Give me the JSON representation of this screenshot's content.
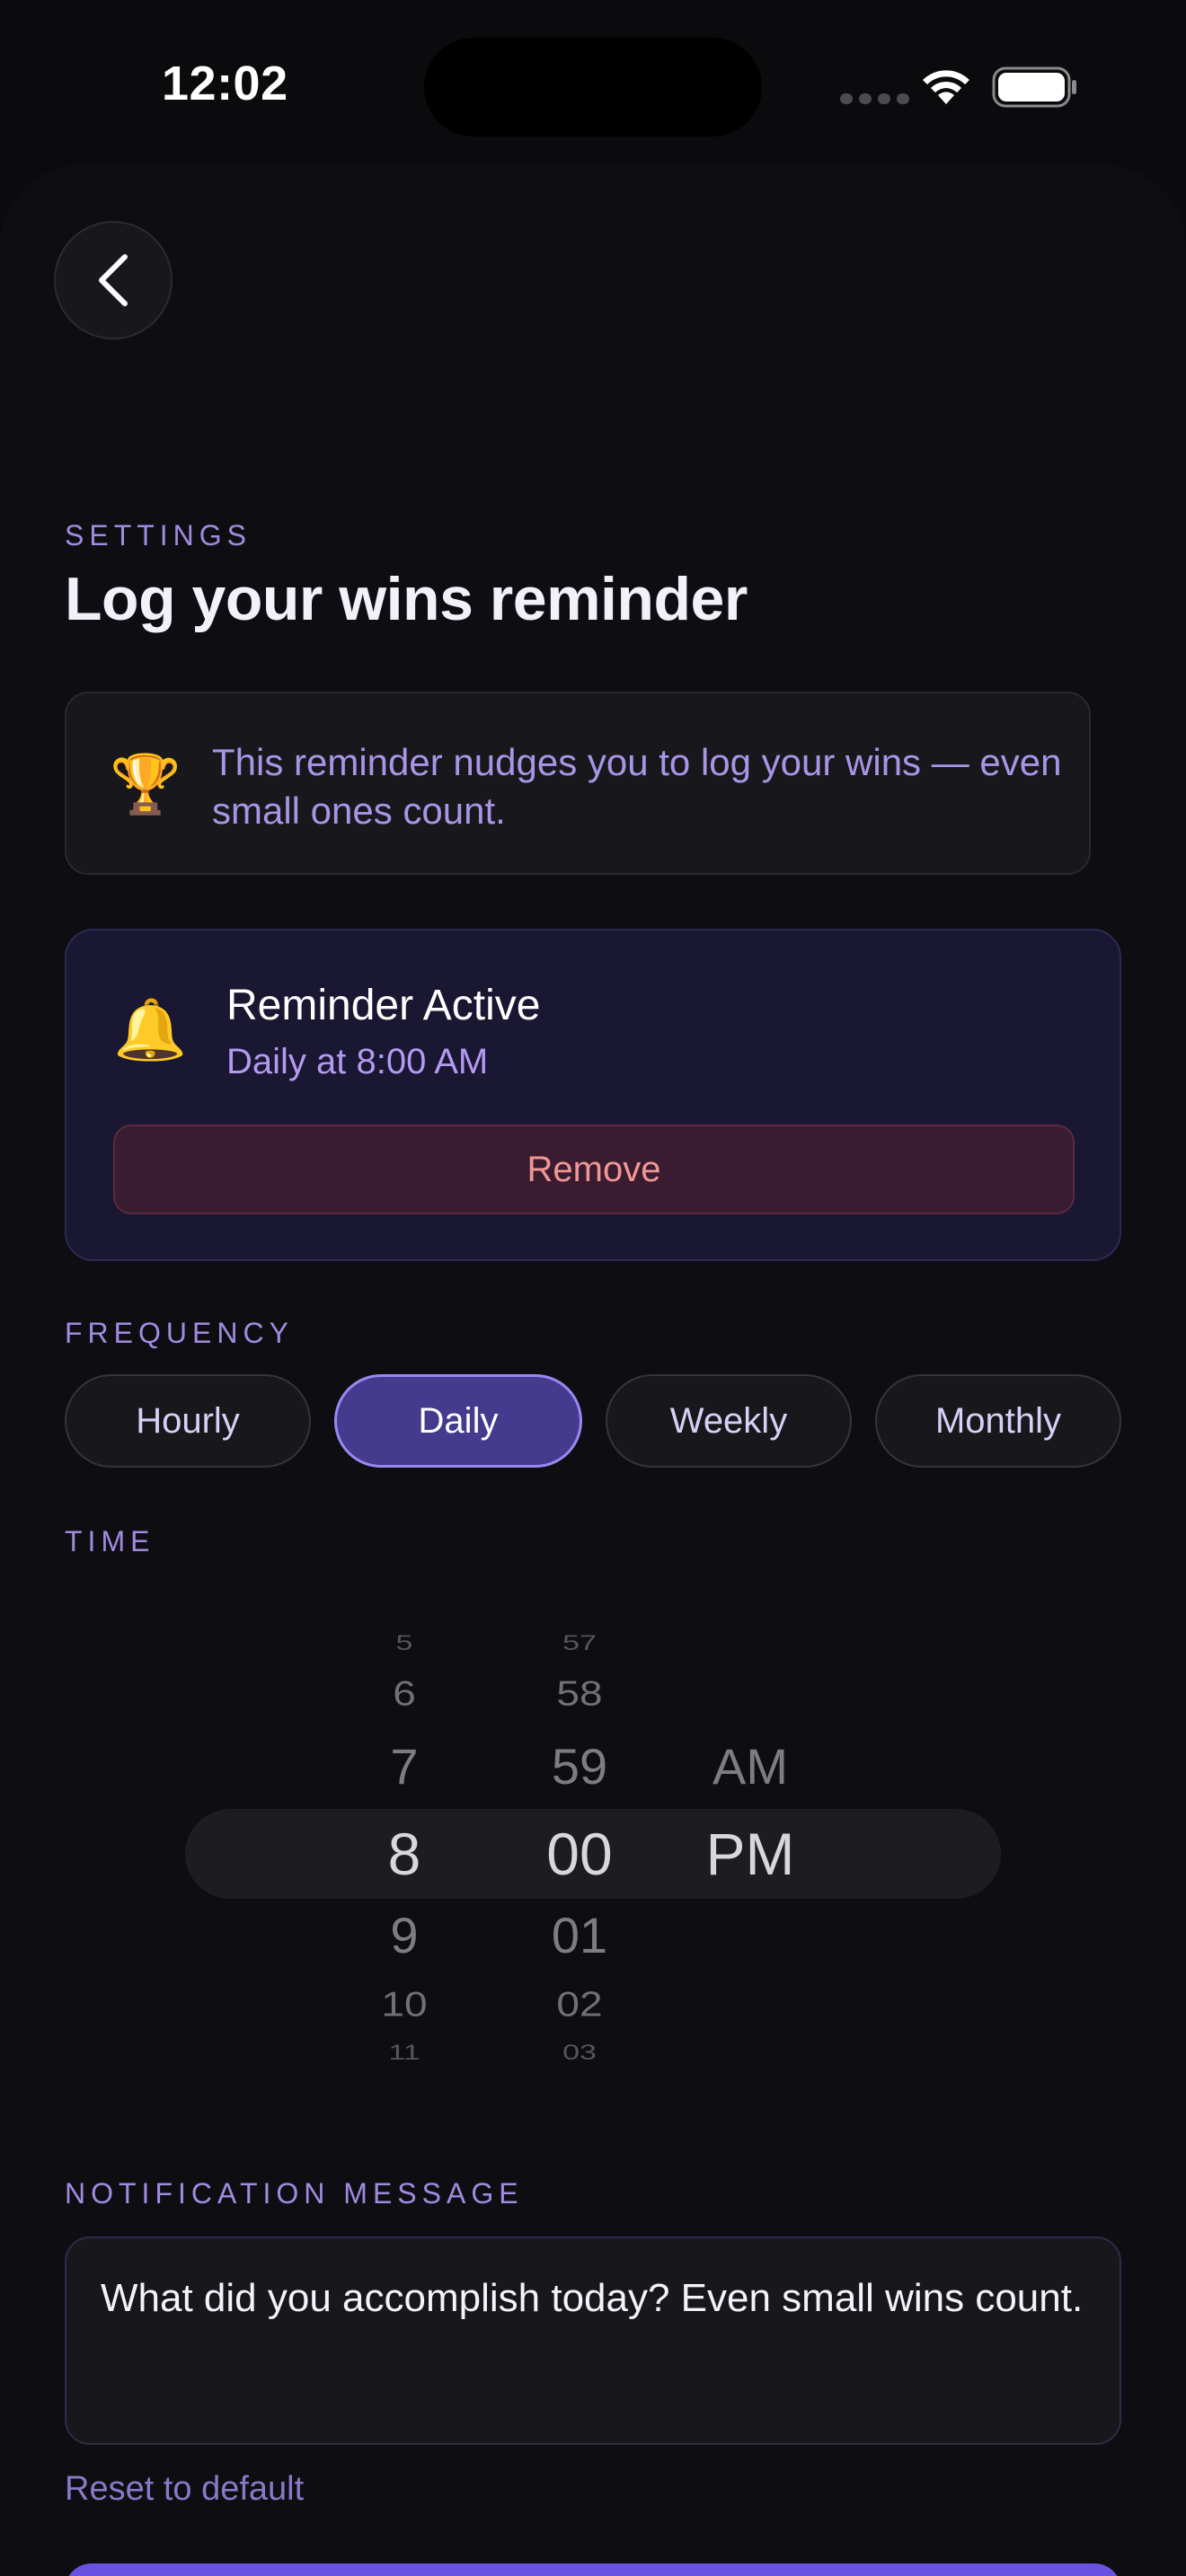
{
  "status_bar": {
    "time": "12:02"
  },
  "header": {
    "eyebrow": "SETTINGS",
    "title": "Log your wins reminder"
  },
  "info": {
    "icon": "trophy-icon",
    "text": "This reminder nudges you to log your wins — even small ones count."
  },
  "active": {
    "icon": "bell-icon",
    "title": "Reminder Active",
    "subtitle": "Daily at 8:00 AM",
    "remove_label": "Remove"
  },
  "frequency": {
    "label": "FREQUENCY",
    "options": [
      "Hourly",
      "Daily",
      "Weekly",
      "Monthly"
    ],
    "selected": "Daily"
  },
  "time": {
    "label": "TIME",
    "hours": [
      "5",
      "6",
      "7",
      "8",
      "9",
      "10",
      "11"
    ],
    "minutes": [
      "57",
      "58",
      "59",
      "00",
      "01",
      "02",
      "03"
    ],
    "periods": [
      "AM",
      "PM"
    ],
    "selected": {
      "hour": "8",
      "minute": "00",
      "period": "PM"
    }
  },
  "notification": {
    "label": "NOTIFICATION MESSAGE",
    "message": "What did you accomplish today? Even small wins count.",
    "reset_label": "Reset to default"
  },
  "colors": {
    "accent": "#443a8e",
    "accent_border": "#9a88f2",
    "label_purple": "#a08be0",
    "danger_text": "#f09696",
    "background": "#0e0e12"
  }
}
